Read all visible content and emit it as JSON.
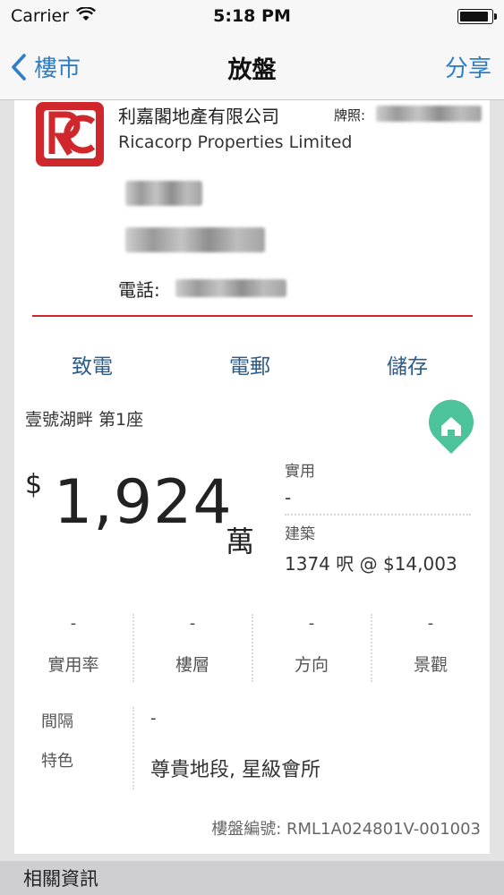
{
  "status_bar": {
    "carrier": "Carrier",
    "time": "5:18 PM",
    "battery_level": 0.9
  },
  "nav": {
    "back_label": "樓市",
    "title": "放盤",
    "share_label": "分享",
    "accent_color": "#2f7fc8"
  },
  "agency": {
    "name_zh": "利嘉閣地產有限公司",
    "name_en": "Ricacorp Properties Limited",
    "license_label": "牌照:",
    "phone_label": "電話:",
    "brand_color": "#d0272d"
  },
  "actions": {
    "call": "致電",
    "email": "電郵",
    "save": "儲存"
  },
  "property": {
    "name": "壹號湖畔 第1座",
    "currency": "$",
    "price": "1,924",
    "price_unit": "萬",
    "saleable_label": "實用",
    "saleable_value": "-",
    "gross_label": "建築",
    "gross_value": "1374 呎 @ $14,003"
  },
  "stats": [
    {
      "value": "-",
      "label": "實用率"
    },
    {
      "value": "-",
      "label": "樓層"
    },
    {
      "value": "-",
      "label": "方向"
    },
    {
      "value": "-",
      "label": "景觀"
    }
  ],
  "details": {
    "layout_label": "間隔",
    "layout_value": "-",
    "features_label": "特色",
    "features_value": "尊貴地段, 星級會所"
  },
  "listing": {
    "number_text": "樓盤編號: RML1A024801V-001003"
  },
  "related": {
    "title": "相關資訊"
  }
}
